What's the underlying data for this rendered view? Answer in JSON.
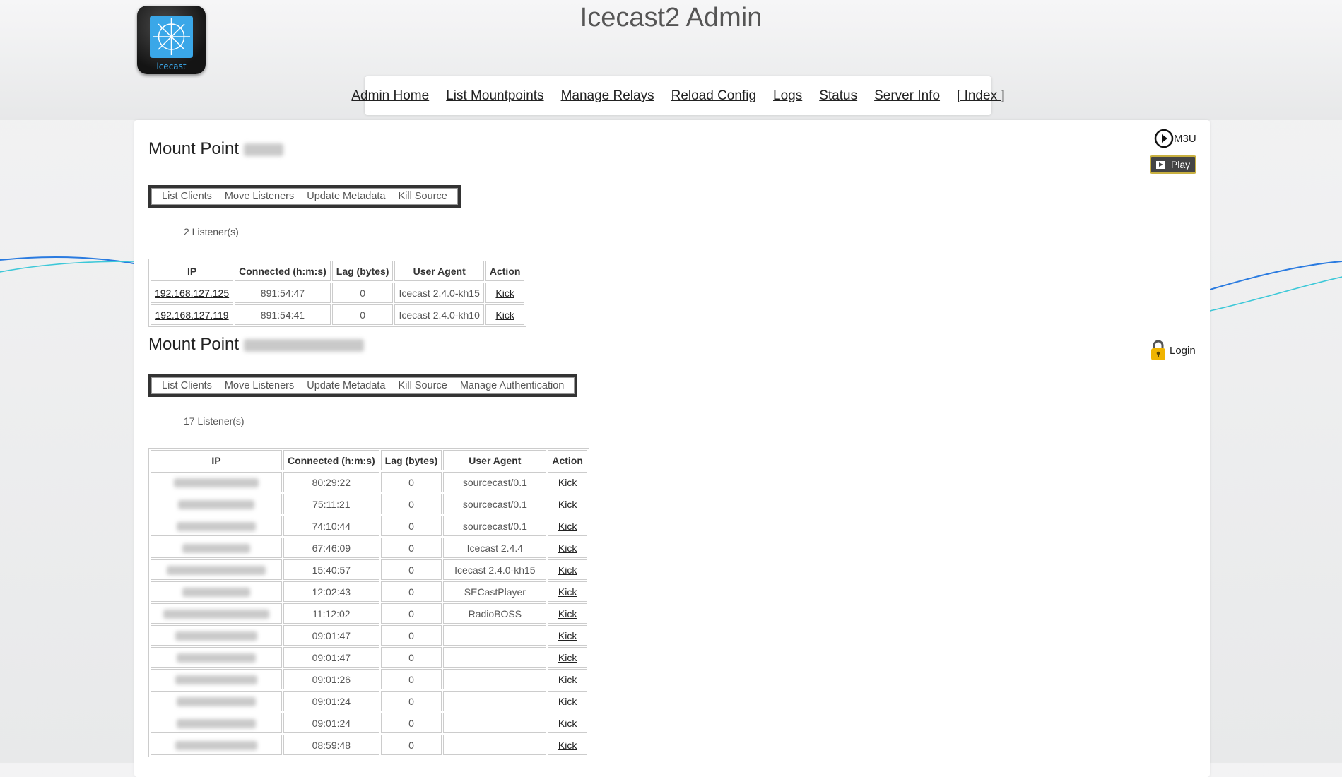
{
  "header": {
    "title": "Icecast2 Admin",
    "logo_text": "icecast",
    "nav": [
      "Admin Home",
      "List Mountpoints",
      "Manage Relays",
      "Reload Config",
      "Logs",
      "Status",
      "Server Info",
      "[ Index ]"
    ]
  },
  "mounts": [
    {
      "title": "Mount Point",
      "actions": [
        "List Clients",
        "Move Listeners",
        "Update Metadata",
        "Kill Source"
      ],
      "listeners_text": "2 Listener(s)",
      "columns": [
        "IP",
        "Connected (h:m:s)",
        "Lag (bytes)",
        "User Agent",
        "Action"
      ],
      "rows": [
        {
          "ip": "192.168.127.125",
          "connected": "891:54:47",
          "lag": "0",
          "agent": "Icecast 2.4.0-kh15",
          "action": "Kick"
        },
        {
          "ip": "192.168.127.119",
          "connected": "891:54:41",
          "lag": "0",
          "agent": "Icecast 2.4.0-kh10",
          "action": "Kick"
        }
      ],
      "m3u_label": "M3U",
      "play_label": "Play"
    },
    {
      "title": "Mount Point",
      "actions": [
        "List Clients",
        "Move Listeners",
        "Update Metadata",
        "Kill Source",
        "Manage Authentication"
      ],
      "listeners_text": "17 Listener(s)",
      "columns": [
        "IP",
        "Connected (h:m:s)",
        "Lag (bytes)",
        "User Agent",
        "Action"
      ],
      "rows": [
        {
          "ip": "",
          "connected": "80:29:22",
          "lag": "0",
          "agent": "sourcecast/0.1",
          "action": "Kick"
        },
        {
          "ip": "",
          "connected": "75:11:21",
          "lag": "0",
          "agent": "sourcecast/0.1",
          "action": "Kick"
        },
        {
          "ip": "",
          "connected": "74:10:44",
          "lag": "0",
          "agent": "sourcecast/0.1",
          "action": "Kick"
        },
        {
          "ip": "",
          "connected": "67:46:09",
          "lag": "0",
          "agent": "Icecast 2.4.4",
          "action": "Kick"
        },
        {
          "ip": "",
          "connected": "15:40:57",
          "lag": "0",
          "agent": "Icecast 2.4.0-kh15",
          "action": "Kick"
        },
        {
          "ip": "",
          "connected": "12:02:43",
          "lag": "0",
          "agent": "SECastPlayer",
          "action": "Kick"
        },
        {
          "ip": "",
          "connected": "11:12:02",
          "lag": "0",
          "agent": "RadioBOSS",
          "action": "Kick"
        },
        {
          "ip": "",
          "connected": "09:01:47",
          "lag": "0",
          "agent": "",
          "action": "Kick"
        },
        {
          "ip": "",
          "connected": "09:01:47",
          "lag": "0",
          "agent": "",
          "action": "Kick"
        },
        {
          "ip": "",
          "connected": "09:01:26",
          "lag": "0",
          "agent": "",
          "action": "Kick"
        },
        {
          "ip": "",
          "connected": "09:01:24",
          "lag": "0",
          "agent": "",
          "action": "Kick"
        },
        {
          "ip": "",
          "connected": "09:01:24",
          "lag": "0",
          "agent": "",
          "action": "Kick"
        },
        {
          "ip": "",
          "connected": "08:59:48",
          "lag": "0",
          "agent": "",
          "action": "Kick"
        }
      ],
      "login_label": "Login"
    }
  ],
  "icons": {
    "play": "play-circle-icon",
    "lock": "lock-icon"
  },
  "colors": {
    "accent_gold": "#c8b040",
    "wave_blue": "#2a7be0",
    "wave_cyan": "#3cc8d8"
  }
}
